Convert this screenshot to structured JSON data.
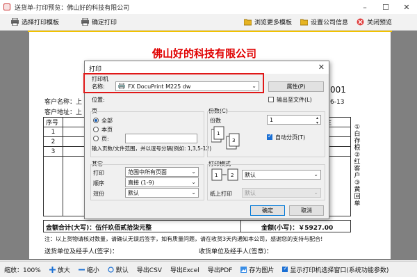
{
  "window": {
    "title": "送货单-打印预览：佛山好的科技有限公司"
  },
  "toolbar": {
    "select_template": "选择打印模板",
    "confirm_print": "确定打印",
    "browse_templates": "浏览更多模板",
    "company_info": "设置公司信息",
    "close_preview": "关闭预览"
  },
  "document": {
    "company": "佛山好的科技有限公司",
    "customer_name_label": "客户名称：上",
    "customer_addr_label": "客户地址：上",
    "doc_no_tail": "001",
    "date_tail": "6-13",
    "table": {
      "headers": [
        "序号",
        "",
        "",
        "",
        "",
        "",
        "注"
      ],
      "rows": [
        [
          "1",
          "惠普",
          "",
          "",
          "",
          "",
          ""
        ],
        [
          "2",
          "",
          "",
          "",
          "",
          "",
          ""
        ],
        [
          "3",
          "爱普",
          "",
          "",
          "",
          "",
          ""
        ]
      ]
    },
    "side_text": "①白存根 ②红客户 ③黄回单",
    "total_words": "金额合计(大写)：伍仟玖佰贰拾柒元整",
    "total_num": "金额(小写)：￥5927.00",
    "note": "注：以上货物请核对数量，请确认无误后签字，如有质量问题，请在收货3天内通知本公司，感谢您的支持与配合!",
    "sender": "送货单位及经手人(签字)：",
    "receiver": "收货单位及经手人(签章)："
  },
  "dialog": {
    "title": "打印",
    "printer_group": "打印机",
    "name_label": "名称:",
    "printer_value": "FX DocuPrint M225 dw",
    "properties": "属性(P)",
    "location_label": "位置:",
    "print_to_file": "输出至文件(L)",
    "pages_group": "页",
    "all": "全部",
    "current": "本页",
    "pages": "页:",
    "page_hint": "输入页数/文件范围，并以逗号分隔(例如: 1,3,5-12)",
    "copies_group": "份数(C)",
    "copies_label": "份数",
    "copies_value": "1",
    "collate": "自动分页(T)",
    "other_group": "其它",
    "print_label": "打印",
    "print_value": "范围中所有页面",
    "order_label": "顺序",
    "order_value": "直接 (1-9)",
    "pages_per_label": "效份",
    "pages_per_value": "默认",
    "mode_group": "打印模式",
    "mode_value": "默认",
    "paper_label": "纸上打印",
    "paper_value": "默认",
    "ok": "确定",
    "cancel": "取消"
  },
  "statusbar": {
    "zoom": "缩放：100%",
    "zoom_in": "放大",
    "zoom_out": "缩小",
    "default": "默认",
    "export_csv": "导出CSV",
    "export_excel": "导出Excel",
    "export_pdf": "导出PDF",
    "save_image": "存为图片",
    "show_dialog": "显示打印机选择窗口(系统功能参数)"
  },
  "colors": {
    "accent": "#e00000",
    "highlight": "#e01818",
    "preview_bg": "#808080"
  }
}
